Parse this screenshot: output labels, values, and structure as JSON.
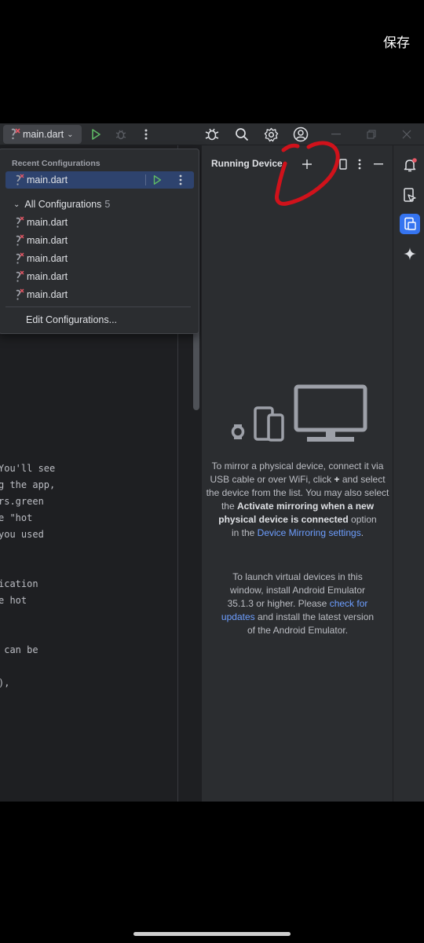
{
  "phone": {
    "save_label": "保存"
  },
  "toolbar": {
    "run_config": "main.dart"
  },
  "editor": {
    "lines": [
      "You'll see",
      "g the app,",
      "rs.green",
      "e \"hot",
      "you used",
      "ication",
      "e hot",
      " can be",
      "),"
    ]
  },
  "popup": {
    "recent_header": "Recent Configurations",
    "recent_item": "main.dart",
    "all_label": "All Configurations",
    "all_count": "5",
    "items": [
      "main.dart",
      "main.dart",
      "main.dart",
      "main.dart",
      "main.dart"
    ],
    "edit_label": "Edit Configurations..."
  },
  "running_devices": {
    "title": "Running Devices",
    "msg1_a": "To mirror a physical device, connect it via USB cable or over WiFi, click",
    "msg1_plus": "+",
    "msg1_b": "and select the device from the list. You may also select the",
    "msg1_bold": "Activate mirroring when a new physical device is connected",
    "msg1_c": "option",
    "msg1_d": "in the",
    "msg1_link": "Device Mirroring settings",
    "msg1_e": ".",
    "msg2_a": "To launch virtual devices in this window, install Android Emulator 35.1.3 or higher. Please",
    "msg2_link": "check for updates",
    "msg2_b": "and install the latest version of the Android Emulator."
  },
  "colors": {
    "accent": "#3574f0",
    "link": "#6d9eff",
    "run_green": "#5fb865",
    "annotation": "#d0121b"
  }
}
